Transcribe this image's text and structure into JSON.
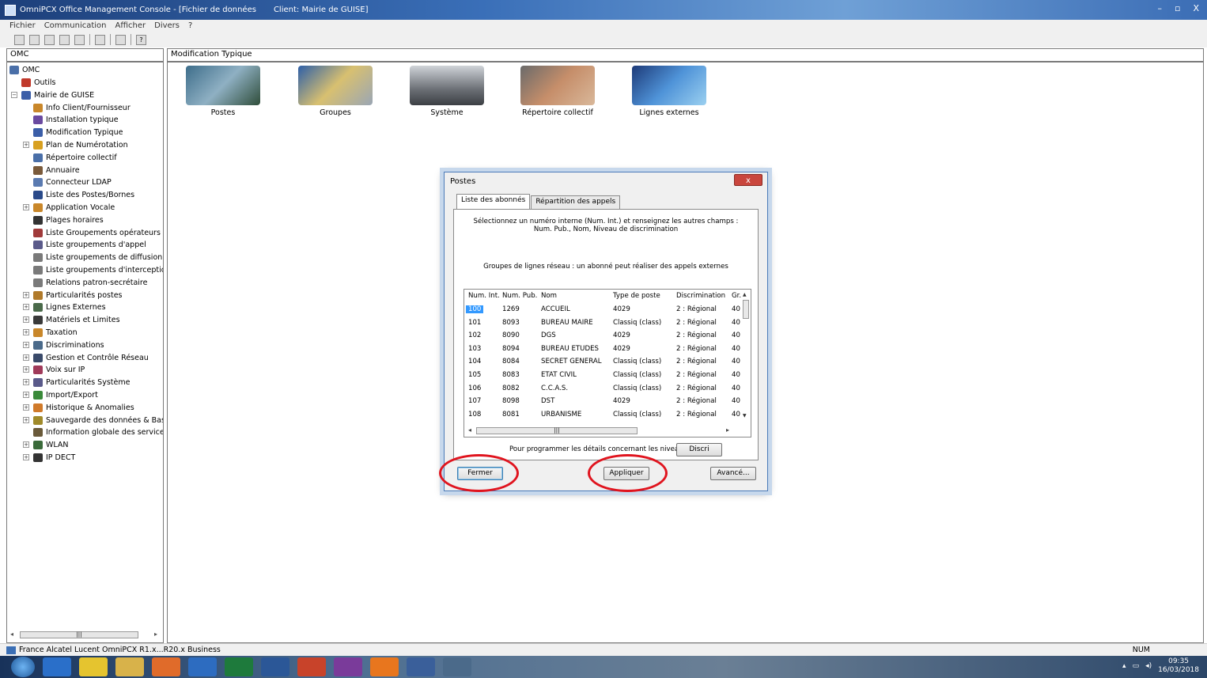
{
  "window": {
    "title": "OmniPCX Office Management Console - [Fichier de données",
    "client": "Client: Mairie de GUISE]",
    "controls": [
      "–",
      "▫",
      "X"
    ]
  },
  "menu": [
    "Fichier",
    "Communication",
    "Afficher",
    "Divers",
    "?"
  ],
  "left_header": "OMC",
  "right_header": "Modification Typique",
  "tree": {
    "root": "OMC",
    "items": [
      {
        "label": "Outils"
      },
      {
        "label": "Mairie de GUISE"
      },
      {
        "label": "Info Client/Fournisseur"
      },
      {
        "label": "Installation typique"
      },
      {
        "label": "Modification Typique"
      },
      {
        "label": "Plan de Numérotation"
      },
      {
        "label": "Répertoire collectif"
      },
      {
        "label": "Annuaire"
      },
      {
        "label": "Connecteur LDAP"
      },
      {
        "label": "Liste des Postes/Bornes"
      },
      {
        "label": "Application Vocale"
      },
      {
        "label": "Plages horaires"
      },
      {
        "label": "Liste Groupements opérateurs"
      },
      {
        "label": "Liste groupements d'appel"
      },
      {
        "label": "Liste groupements de diffusion"
      },
      {
        "label": "Liste groupements d'interception"
      },
      {
        "label": "Relations patron-secrétaire"
      },
      {
        "label": "Particularités postes"
      },
      {
        "label": "Lignes Externes"
      },
      {
        "label": "Matériels et Limites"
      },
      {
        "label": "Taxation"
      },
      {
        "label": "Discriminations"
      },
      {
        "label": "Gestion et Contrôle Réseau"
      },
      {
        "label": "Voix sur IP"
      },
      {
        "label": "Particularités Système"
      },
      {
        "label": "Import/Export"
      },
      {
        "label": "Historique & Anomalies"
      },
      {
        "label": "Sauvegarde des données & Bascule"
      },
      {
        "label": "Information globale des services ce"
      },
      {
        "label": "WLAN"
      },
      {
        "label": "IP DECT"
      }
    ]
  },
  "icons": [
    {
      "label": "Postes"
    },
    {
      "label": "Groupes"
    },
    {
      "label": "Système"
    },
    {
      "label": "Répertoire collectif"
    },
    {
      "label": "Lignes externes"
    }
  ],
  "dialog": {
    "title": "Postes",
    "close": "x",
    "tabs": [
      "Liste des abonnés",
      "Répartition des appels"
    ],
    "instruction_1": "Sélectionnez un numéro interne (Num. Int.) et renseignez les autres champs :",
    "instruction_2": "Num. Pub., Nom, Niveau de discrimination",
    "instruction_3": "Groupes de lignes réseau : un abonné peut réaliser des appels externes",
    "columns": [
      "Num. Int.",
      "Num. Pub.",
      "Nom",
      "Type de poste",
      "Discrimination",
      "Gr."
    ],
    "rows": [
      [
        "100",
        "1269",
        "ACCUEIL",
        "4029",
        "2 : Régional",
        "40"
      ],
      [
        "101",
        "8093",
        "BUREAU MAIRE",
        "Classiq (class)",
        "2 : Régional",
        "40"
      ],
      [
        "102",
        "8090",
        "DGS",
        "4029",
        "2 : Régional",
        "40"
      ],
      [
        "103",
        "8094",
        "BUREAU ETUDES",
        "4029",
        "2 : Régional",
        "40"
      ],
      [
        "104",
        "8084",
        "SECRET GENERAL",
        "Classiq (class)",
        "2 : Régional",
        "40"
      ],
      [
        "105",
        "8083",
        "ETAT CIVIL",
        "Classiq (class)",
        "2 : Régional",
        "40"
      ],
      [
        "106",
        "8082",
        "C.C.A.S.",
        "Classiq (class)",
        "2 : Régional",
        "40"
      ],
      [
        "107",
        "8098",
        "DST",
        "4029",
        "2 : Régional",
        "40"
      ],
      [
        "108",
        "8081",
        "URBANISME",
        "Classiq (class)",
        "2 : Régional",
        "40"
      ]
    ],
    "discri_text": "Pour programmer les détails concernant les niveaux de",
    "discri_button": "Discri",
    "fermer": "Fermer",
    "appliquer": "Appliquer",
    "avance": "Avancé..."
  },
  "status": {
    "text": "France Alcatel Lucent OmniPCX R1.x...R20.x Business",
    "num": "NUM"
  },
  "taskbar": {
    "time": "09:35",
    "date": "16/03/2018"
  },
  "colors": {
    "selection": "#3399ff",
    "annotation_ring": "#e0141e",
    "title_bar": "#1d3f7a"
  }
}
